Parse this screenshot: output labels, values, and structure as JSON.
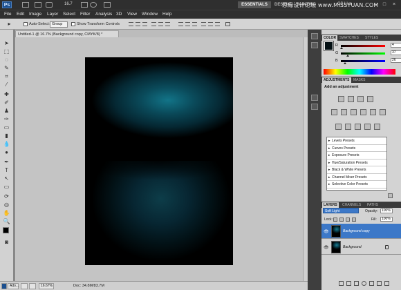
{
  "app": {
    "logo": "Ps",
    "zoom": "16.7",
    "workspaces": {
      "essentials": "ESSENTIALS",
      "design": "DESIGN",
      "painting": "PAINTING"
    },
    "watermark": "思缘设计论坛 www.MISSYUAN.COM",
    "cslive": "CS Live"
  },
  "menu": [
    "File",
    "Edit",
    "Image",
    "Layer",
    "Select",
    "Filter",
    "Analysis",
    "3D",
    "View",
    "Window",
    "Help"
  ],
  "options": {
    "auto_select_label": "Auto-Select:",
    "auto_select_value": "Group",
    "transform_label": "Show Transform Controls"
  },
  "document": {
    "tab_title": "Untitled-1 @ 16.7% (Background copy, CMYK/8) *",
    "status": "Doc: 34.8M/83.7M"
  },
  "taskbar": {
    "zoom": "16.67%",
    "label": "Ado..."
  },
  "color_panel": {
    "tabs": [
      "COLOR",
      "SWATCHES",
      "STYLES"
    ],
    "sliders": [
      {
        "label": "R",
        "value": "4",
        "fraction": 0.02,
        "gradient": [
          "#000000",
          "#ff0000"
        ]
      },
      {
        "label": "G",
        "value": "37",
        "fraction": 0.15,
        "gradient": [
          "#000000",
          "#00ff00"
        ]
      },
      {
        "label": "B",
        "value": "26",
        "fraction": 0.1,
        "gradient": [
          "#000000",
          "#0000ff"
        ]
      }
    ],
    "foreground": "#041014"
  },
  "adjustments": {
    "tabs": [
      "ADJUSTMENTS",
      "MASKS"
    ],
    "title": "Add an adjustment",
    "presets": [
      "Levels Presets",
      "Curves Presets",
      "Exposure Presets",
      "Hue/Saturation Presets",
      "Black & White Presets",
      "Channel Mixer Presets",
      "Selective Color Presets"
    ]
  },
  "layers": {
    "tabs": [
      "LAYERS",
      "CHANNELS",
      "PATHS"
    ],
    "blend_mode": "Soft Light",
    "opacity_label": "Opacity:",
    "opacity": "100%",
    "lock_label": "Lock:",
    "fill_label": "Fill:",
    "fill": "100%",
    "items": [
      {
        "name": "Background copy",
        "selected": true
      },
      {
        "name": "Background",
        "selected": false,
        "locked": true
      }
    ]
  }
}
